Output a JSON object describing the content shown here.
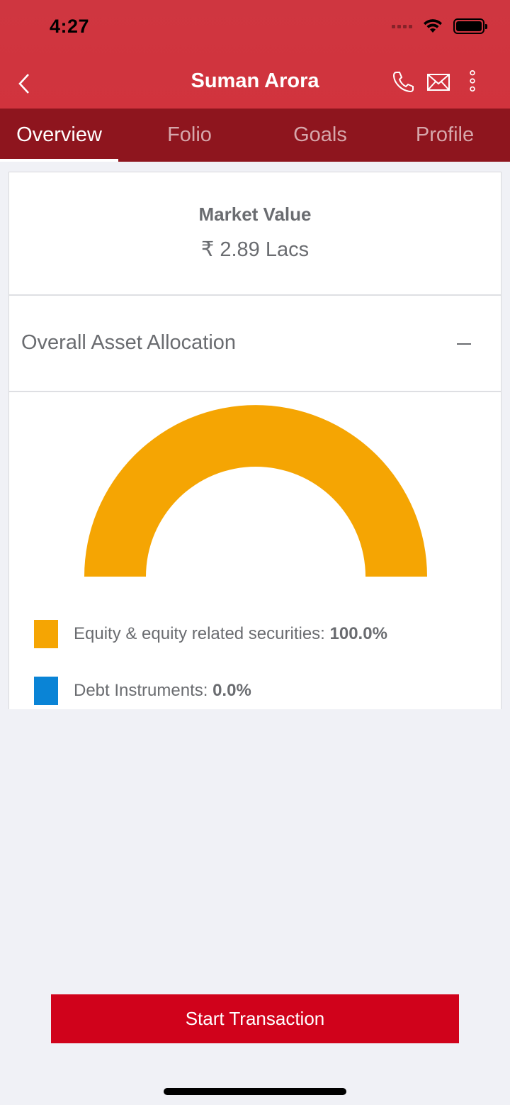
{
  "status_bar": {
    "time": "4:27"
  },
  "header": {
    "title": "Suman Arora"
  },
  "tabs": [
    {
      "label": "Overview",
      "active": true
    },
    {
      "label": "Folio",
      "active": false
    },
    {
      "label": "Goals",
      "active": false
    },
    {
      "label": "Profile",
      "active": false
    }
  ],
  "market_value": {
    "label": "Market Value",
    "value": "₹ 2.89 Lacs"
  },
  "asset_allocation": {
    "title": "Overall Asset Allocation",
    "legend": [
      {
        "label": "Equity & equity related securities: ",
        "value": "100.0%",
        "color": "#f5a503"
      },
      {
        "label": "Debt Instruments: ",
        "value": "0.0%",
        "color": "#0a84d6"
      }
    ]
  },
  "chart_data": {
    "type": "pie",
    "categories": [
      "Equity & equity related securities",
      "Debt Instruments"
    ],
    "values": [
      100.0,
      0.0
    ],
    "colors": [
      "#f5a503",
      "#0a84d6"
    ]
  },
  "actions": {
    "start_transaction": "Start Transaction"
  },
  "colors": {
    "header": "#d1333d",
    "tab_bar": "#8e151e",
    "primary_button": "#d0021b"
  }
}
